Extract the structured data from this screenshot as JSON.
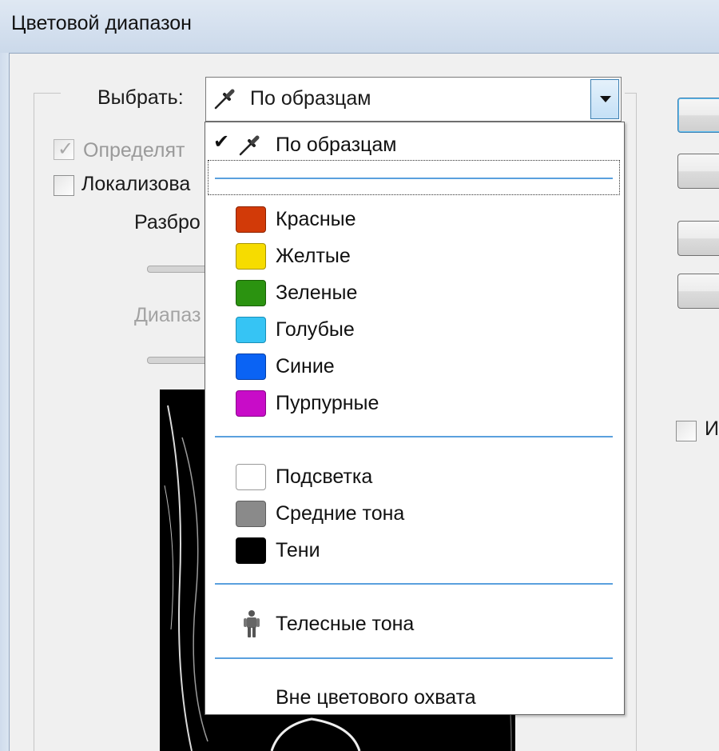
{
  "window": {
    "title": "Цветовой диапазон"
  },
  "select_row": {
    "label": "Выбрать:",
    "value": "По образцам",
    "value_icon": "eyedropper-icon"
  },
  "background_controls": {
    "detect_label": "Определят",
    "localized_label": "Локализова",
    "scatter_label": "Разбро",
    "range_label": "Диапаз",
    "invert_label": "И"
  },
  "dropdown": {
    "sampled": {
      "label": "По образцам",
      "icon": "eyedropper-icon",
      "checked": true
    },
    "colors": [
      {
        "label": "Красные",
        "color": "#d23a08"
      },
      {
        "label": "Желтые",
        "color": "#f6dc00"
      },
      {
        "label": "Зеленые",
        "color": "#2b9310"
      },
      {
        "label": "Голубые",
        "color": "#36c4f4"
      },
      {
        "label": "Синие",
        "color": "#0a63f4"
      },
      {
        "label": "Пурпурные",
        "color": "#c80cc8"
      }
    ],
    "tones": [
      {
        "label": "Подсветка",
        "color": "#ffffff"
      },
      {
        "label": "Средние тона",
        "color": "#8a8a8a"
      },
      {
        "label": "Тени",
        "color": "#000000"
      }
    ],
    "skin": {
      "label": "Телесные тона",
      "icon": "person-icon"
    },
    "out_of_gamut": {
      "label": "Вне цветового охвата"
    }
  },
  "colors": {
    "separator": "#5aa0de",
    "titlebar": "#d3dfee"
  }
}
